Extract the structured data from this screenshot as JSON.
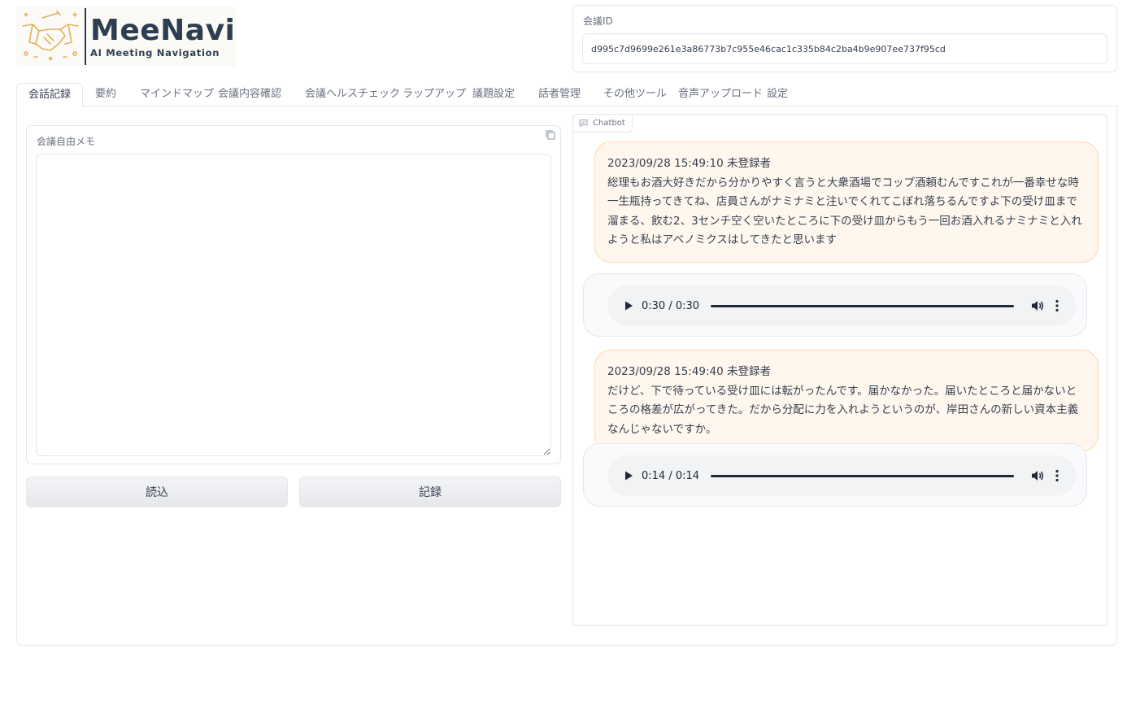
{
  "logo": {
    "brand": "MeeNavi",
    "tagline": "AI Meeting Navigation"
  },
  "meeting_id": {
    "label": "会議ID",
    "value": "d995c7d9699e261e3a86773b7c955e46cac1c335b84c2ba4b9e907ee737f95cd"
  },
  "tabs": [
    {
      "label": "会話記録",
      "active": true
    },
    {
      "label": "要約"
    },
    {
      "label": "マインドマップ"
    },
    {
      "label": "会議内容確認"
    },
    {
      "label": "会議ヘルスチェック"
    },
    {
      "label": "ラップアップ"
    },
    {
      "label": "議題設定"
    },
    {
      "label": "話者管理"
    },
    {
      "label": "その他ツール"
    },
    {
      "label": "音声アップロード"
    },
    {
      "label": "設定"
    }
  ],
  "memo": {
    "label": "会議自由メモ",
    "value": ""
  },
  "buttons": {
    "load": "読込",
    "record": "記録"
  },
  "chatbot": {
    "label": "Chatbot",
    "messages": [
      {
        "header": "2023/09/28 15:49:10 未登録者",
        "text": "総理もお酒大好きだから分かりやすく言うと大衆酒場でコップ酒頼むんですこれが一番幸せな時一生瓶持ってきてね、店員さんがナミナミと注いでくれてこぼれ落ちるんですよ下の受け皿まで溜まる、飲む2、3センチ空く空いたところに下の受け皿からもう一回お酒入れるナミナミと入れようと私はアベノミクスはしてきたと思います"
      },
      {
        "audio_time": "0:30 / 0:30"
      },
      {
        "header": "2023/09/28 15:49:40 未登録者",
        "text": "だけど、下で待っている受け皿には転がったんです。届かなかった。届いたところと届かないところの格差が広がってきた。だから分配に力を入れようというのが、岸田さんの新しい資本主義なんじゃないですか。"
      },
      {
        "audio_time": "0:14 / 0:14"
      }
    ]
  },
  "colors": {
    "user_bubble_bg": "#fff7ed",
    "user_bubble_border": "#fed7aa",
    "logo_text": "#2c3e50",
    "logo_art": "#e0b25a"
  },
  "icons": {
    "copy": "copy-icon",
    "chat": "chat-icon",
    "play": "play-icon",
    "volume": "volume-icon",
    "more": "more-vertical-icon"
  }
}
